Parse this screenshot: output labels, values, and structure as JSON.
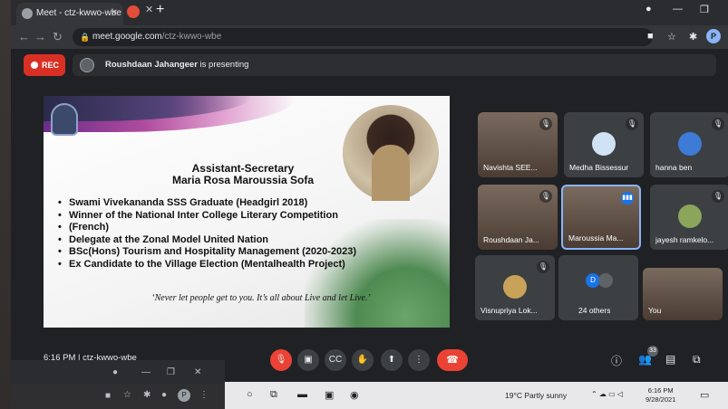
{
  "browser": {
    "tab_title": "Meet - ctz-kwwo-wbe",
    "url_host": "meet.google.com",
    "url_path": "/ctz-kwwo-wbe",
    "profile_initial": "P"
  },
  "meet": {
    "rec_label": "REC",
    "presenting_name": "Roushdaan Jahangeer",
    "presenting_suffix": " is presenting",
    "time": "6:16 PM",
    "meeting_code": "ctz-kwwo-wbe",
    "participant_count": "33"
  },
  "slide": {
    "title_line1": "Assistant-Secretary",
    "title_line2": "Maria Rosa Maroussia Sofa",
    "bullets": [
      "Swami Vivekananda SSS Graduate (Headgirl 2018)",
      "Winner of the National Inter College Literary Competition",
      "(French)",
      "Delegate at the Zonal Model United Nation",
      "BSc(Hons) Tourism and Hospitality Management (2020-2023)",
      "Ex Candidate to the Village Election (Mentalhealth Project)"
    ],
    "quote": "‘Never let people get to you. It’s all about Live and let Live.’"
  },
  "tiles": [
    {
      "name": "Navishta SEE..."
    },
    {
      "name": "Medha Bissessur"
    },
    {
      "name": "hanna ben"
    },
    {
      "name": "Roushdaan Ja..."
    },
    {
      "name": "Maroussia Ma..."
    },
    {
      "name": "jayesh ramkelo..."
    },
    {
      "name": "Visnupriya Lok..."
    },
    {
      "name": "24 others",
      "initial": "D"
    },
    {
      "name": "You"
    }
  ],
  "taskbar": {
    "weather": "19°C  Partly sunny",
    "clock_time": "6:16 PM",
    "clock_date": "9/28/2021"
  },
  "colors": {
    "accent": "#1a73e8",
    "record_red": "#d93025",
    "hangup_red": "#ea4335",
    "active_border": "#8ab4f8"
  }
}
